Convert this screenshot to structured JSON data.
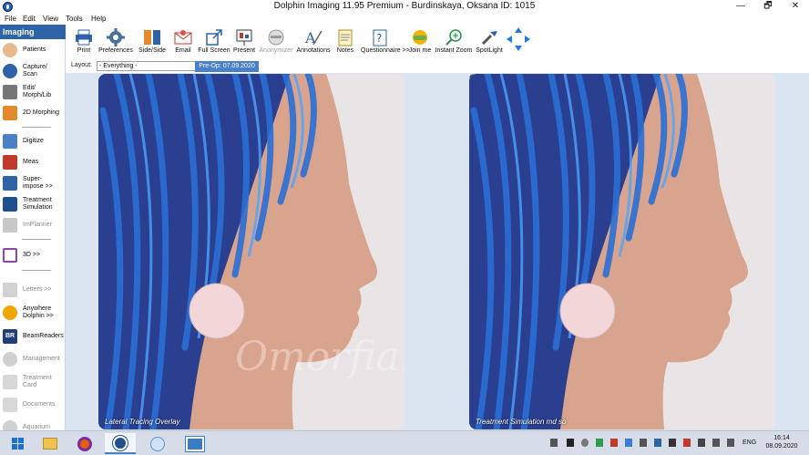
{
  "window": {
    "title": "Dolphin Imaging 11.95 Premium - Burdinskaya, Oksana  ID: 1015",
    "minimize": "—",
    "maximize": "🗗",
    "close": "✕"
  },
  "menu": [
    "File",
    "Edit",
    "View",
    "Tools",
    "Help"
  ],
  "toolbar": [
    {
      "label": "Print",
      "icon": "printer-icon"
    },
    {
      "label": "Preferences",
      "icon": "gear-icon"
    },
    {
      "label": "Side/Side",
      "icon": "side-by-side-icon"
    },
    {
      "label": "Email",
      "icon": "email-icon"
    },
    {
      "label": "Full Screen",
      "icon": "fullscreen-icon"
    },
    {
      "label": "Present",
      "icon": "presentation-icon"
    },
    {
      "label": "Anonymizer",
      "icon": "anonymizer-icon",
      "disabled": true
    },
    {
      "label": "Annotations",
      "icon": "annotation-icon"
    },
    {
      "label": "Notes",
      "icon": "notes-icon"
    },
    {
      "label": "Questionnaire >>",
      "icon": "questionnaire-icon"
    },
    {
      "label": "Join me",
      "icon": "join-me-icon"
    },
    {
      "label": "Instant Zoom",
      "icon": "zoom-icon"
    },
    {
      "label": "SpotLight",
      "icon": "spotlight-icon"
    },
    {
      "label": "",
      "icon": "move-arrows-icon"
    }
  ],
  "layout": {
    "label": "Layout:",
    "value": "- Everything -",
    "date_tab": "Pre-Op: 07.09.2020"
  },
  "sidebar": {
    "title": "Imaging",
    "items": [
      {
        "label": "Patients",
        "icon": "patient-icon"
      },
      {
        "label": "Capture/\nScan",
        "icon": "capture-icon"
      },
      {
        "label": "Edit/\nMorph/Lib",
        "icon": "edit-icon"
      },
      {
        "label": "2D Morphing",
        "icon": "morphing-icon"
      },
      {
        "label": "Digitize",
        "icon": "digitize-icon"
      },
      {
        "label": "Meas",
        "icon": "measure-icon"
      },
      {
        "label": "Super-\nimpose >>",
        "icon": "superimpose-icon"
      },
      {
        "label": "Treatment\nSimulation",
        "icon": "treatment-simulation-icon"
      },
      {
        "label": "ImPlanner",
        "icon": "implant-icon",
        "disabled": true
      },
      {
        "label": "3D >>",
        "icon": "3d-icon"
      },
      {
        "label": "Letters >>",
        "icon": "letters-icon",
        "disabled": true
      },
      {
        "label": "Anywhere\nDolphin >>",
        "icon": "anywhere-icon"
      },
      {
        "label": "BeamReaders",
        "icon": "beamreaders-icon"
      },
      {
        "label": "Management",
        "icon": "management-icon",
        "disabled": true
      },
      {
        "label": "Treatment\nCard",
        "icon": "treatment-card-icon",
        "disabled": true
      },
      {
        "label": "Documents",
        "icon": "documents-icon",
        "disabled": true
      },
      {
        "label": "Aquarium",
        "icon": "aquarium-icon",
        "disabled": true
      }
    ]
  },
  "photos": [
    {
      "caption": "Lateral Tracing Overlay"
    },
    {
      "caption": "Treatment Simulation md so"
    }
  ],
  "watermark": "Omorfia.ru",
  "taskbar": {
    "apps": [
      "start-icon",
      "explorer-icon",
      "firefox-icon",
      "dolphin-icon",
      "paint-icon",
      "photos-icon"
    ],
    "lang": "ENG",
    "time": "16:14",
    "date": "08.09.2020"
  },
  "colors": {
    "accent": "#2e63a8",
    "content_bg": "#dbe5f1",
    "braid_blue": "#2a6fd6"
  }
}
